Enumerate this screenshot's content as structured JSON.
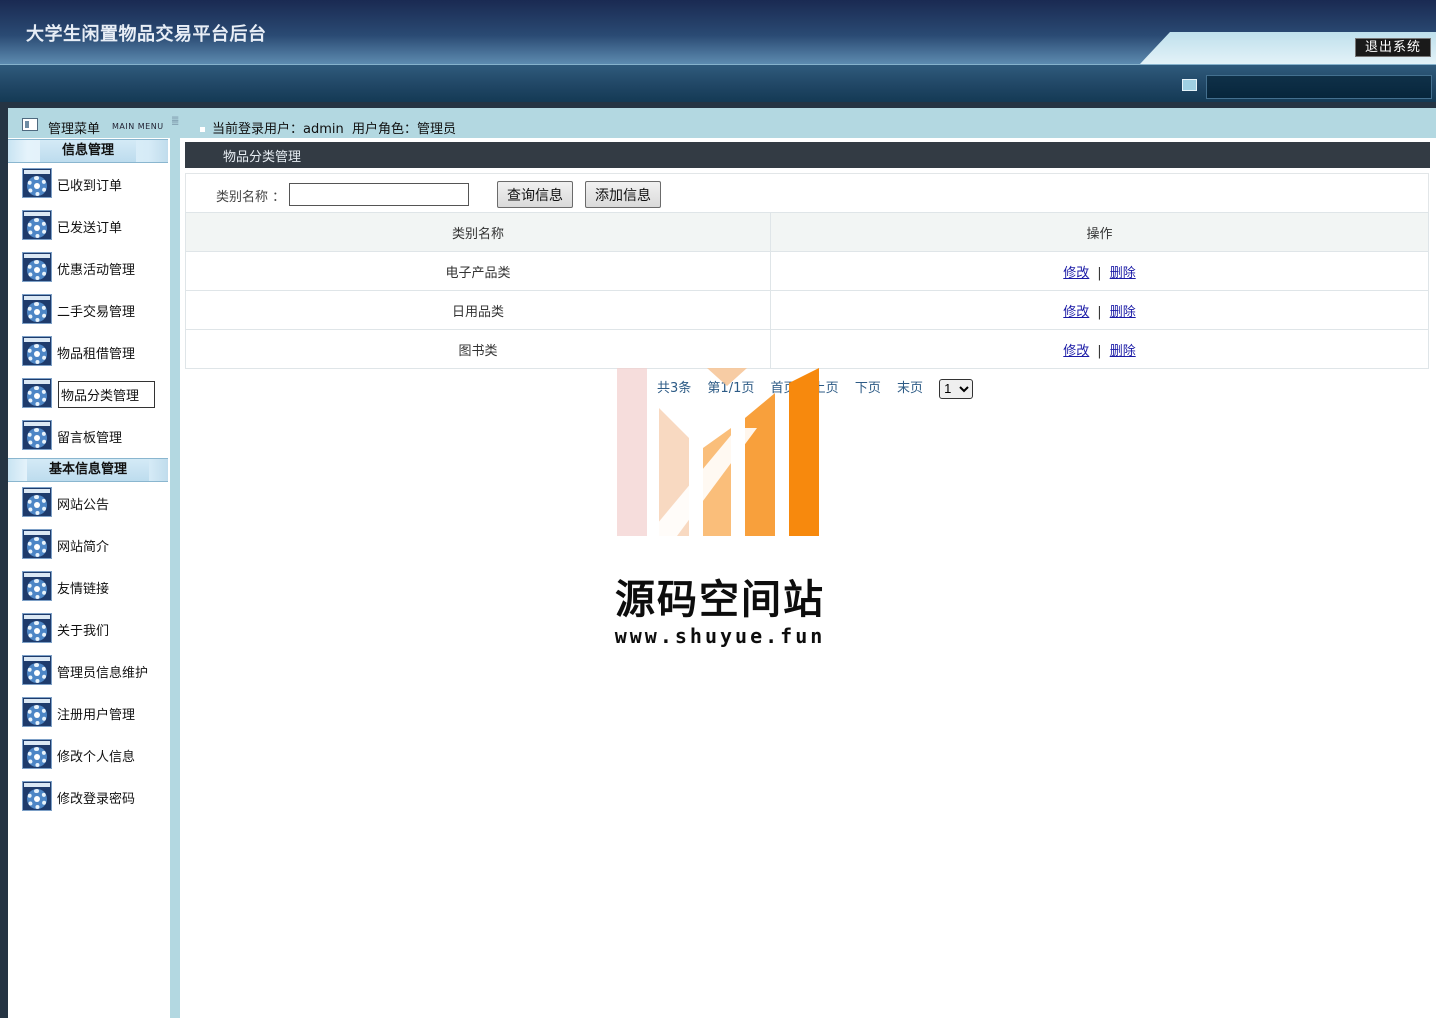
{
  "header": {
    "title": "大学生闲置物品交易平台后台",
    "logout_label": "退出系统"
  },
  "menu": {
    "title": "管理菜单",
    "subtitle": "MAIN MENU"
  },
  "user_info": {
    "text": "当前登录用户：admin  用户角色：管理员"
  },
  "sidebar": {
    "groups": [
      {
        "title": "信息管理",
        "items": [
          "已收到订单",
          "已发送订单",
          "优惠活动管理",
          "二手交易管理",
          "物品租借管理",
          "物品分类管理",
          "留言板管理"
        ]
      },
      {
        "title": "基本信息管理",
        "items": [
          "网站公告",
          "网站简介",
          "友情链接",
          "关于我们",
          "管理员信息维护",
          "注册用户管理",
          "修改个人信息",
          "修改登录密码"
        ]
      }
    ],
    "active_item": "物品分类管理"
  },
  "panel": {
    "title": "物品分类管理"
  },
  "search": {
    "label": "类别名称 ：",
    "value": "",
    "placeholder": "",
    "query_label": "查询信息",
    "add_label": "添加信息"
  },
  "table": {
    "columns": [
      "类别名称",
      "操作"
    ],
    "rows": [
      {
        "name": "电子产品类",
        "edit": "修改",
        "delete": "删除"
      },
      {
        "name": "日用品类",
        "edit": "修改",
        "delete": "删除"
      },
      {
        "name": "图书类",
        "edit": "修改",
        "delete": "删除"
      }
    ],
    "separator": "|"
  },
  "pager": {
    "total": "共3条",
    "page_info": "第1/1页",
    "first": "首页",
    "prev": "上页",
    "next": "下页",
    "last": "末页",
    "select_value": "1"
  },
  "watermark": {
    "brand": "源码空间站",
    "url": "www.shuyue.fun"
  },
  "colors": {
    "header_dark": "#1a2a52",
    "sidebar_frame": "#b3d8e1",
    "panel_title_bg": "#333b44",
    "link": "#1a1aa6",
    "pager_text": "#2d5b86",
    "watermark_orange": "#f7890d"
  }
}
